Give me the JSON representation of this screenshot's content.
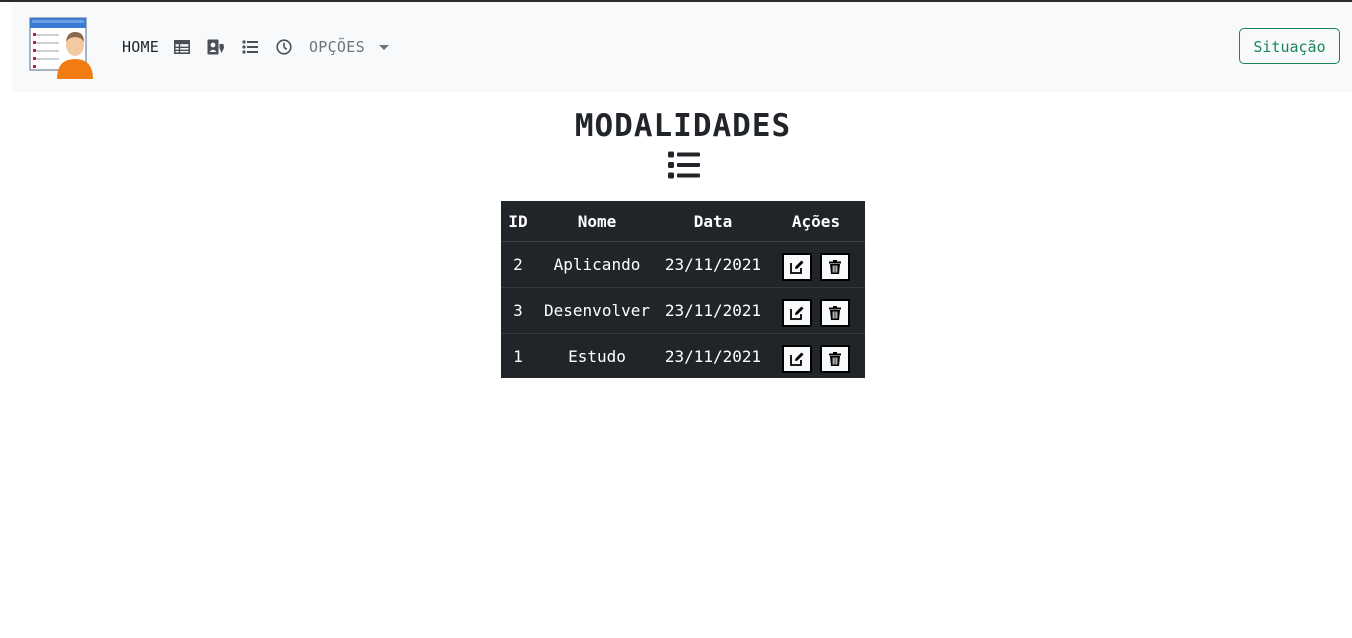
{
  "navbar": {
    "home_label": "HOME",
    "icons": [
      "table-icon",
      "user-tag-icon",
      "list-icon",
      "clock-icon"
    ],
    "opcoes_label": "OPÇÕES",
    "situacao_label": "Situação",
    "accent_color": "#198754"
  },
  "main": {
    "title": "MODALIDADES",
    "title_icon": "list-icon"
  },
  "table": {
    "headers": [
      "ID",
      "Nome",
      "Data",
      "Ações"
    ],
    "rows": [
      {
        "id": "2",
        "nome": "Aplicando",
        "data": "23/11/2021"
      },
      {
        "id": "3",
        "nome": "Desenvolver",
        "data": "23/11/2021"
      },
      {
        "id": "1",
        "nome": "Estudo",
        "data": "23/11/2021"
      }
    ],
    "row_actions": [
      "edit-icon",
      "trash-icon"
    ]
  }
}
